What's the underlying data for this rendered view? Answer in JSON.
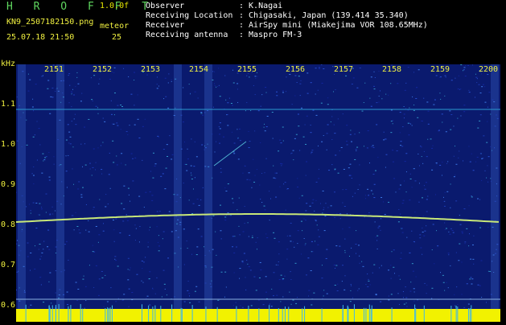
{
  "header": {
    "title": "H R O F F T",
    "version": "1.0.0f",
    "filename": "KN9_2507182150.png",
    "meteor_label": "meteor",
    "datetime": "25.07.18 21:50",
    "meteor_count": "25"
  },
  "info": [
    {
      "label": "Observer",
      "value": ": K.Nagai"
    },
    {
      "label": "Receiving Location",
      "value": ": Chigasaki, Japan (139.414 35.340)"
    },
    {
      "label": "Receiver",
      "value": ": AirSpy mini (Miakejima VOR 108.65MHz)"
    },
    {
      "label": "Receiving antenna",
      "value": ": Maspro FM-3"
    }
  ],
  "axis": {
    "y_unit": "kHz",
    "y_ticks": [
      "1.1",
      "1.0",
      "0.9",
      "0.8",
      "0.7",
      "0.6"
    ],
    "x_ticks": [
      "2151",
      "2152",
      "2153",
      "2154",
      "2155",
      "2156",
      "2157",
      "2158",
      "2159",
      "2200"
    ]
  },
  "colors": {
    "background": "#000000",
    "spectrum_base": "#0a1a6e",
    "trace": "#c8e878",
    "label_text": "#f0f040",
    "title_text": "#5fd65f",
    "noise_floor": "#f2f200"
  }
}
